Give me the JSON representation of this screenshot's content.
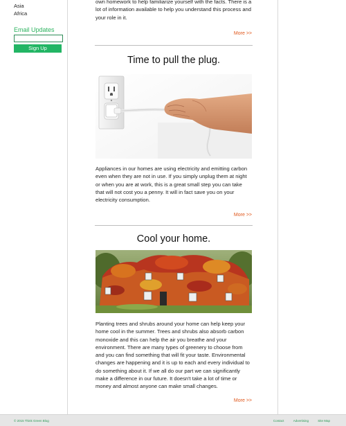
{
  "sidebar": {
    "regions": [
      "Asia",
      "Africa"
    ],
    "email_title": "Email Updates",
    "email_value": "",
    "signup_label": "Sign Up"
  },
  "articles": [
    {
      "text": "own homework to help familiarize yourself with the facts. There is a lot of information available to help you understand this process and your role in it.",
      "more": "More >>"
    },
    {
      "title": "Time to pull the plug.",
      "text": "Appliances in our homes are using electricity and emitting carbon even when they are not in use. If you simply unplug them at night or when you are at work, this is a great small step you can take that will not cost you a penny. It will in fact save you on your electricity consumption.",
      "more": "More >>"
    },
    {
      "title": "Cool your home.",
      "text": "Planting trees and shrubs around your home can help keep your home cool in the summer. Trees and shrubs also absorb carbon monoxide and this can help the air you breathe and your environment. There are many types of greenery to choose from and you can find something that will fit your taste. Environmental changes are happening and it is up to each and every individual to do something about it. If we all do our part we can significantly make a difference in our future. It doesn't take a lot of time or money and almost anyone can make small changes.",
      "more": "More >>"
    }
  ],
  "footer": {
    "copyright": "© 2015 Think Green Blog",
    "links": [
      "Contact",
      "Advertising",
      "Site Map"
    ]
  },
  "colors": {
    "accent_green": "#22b564",
    "more_link": "#e0561a"
  }
}
